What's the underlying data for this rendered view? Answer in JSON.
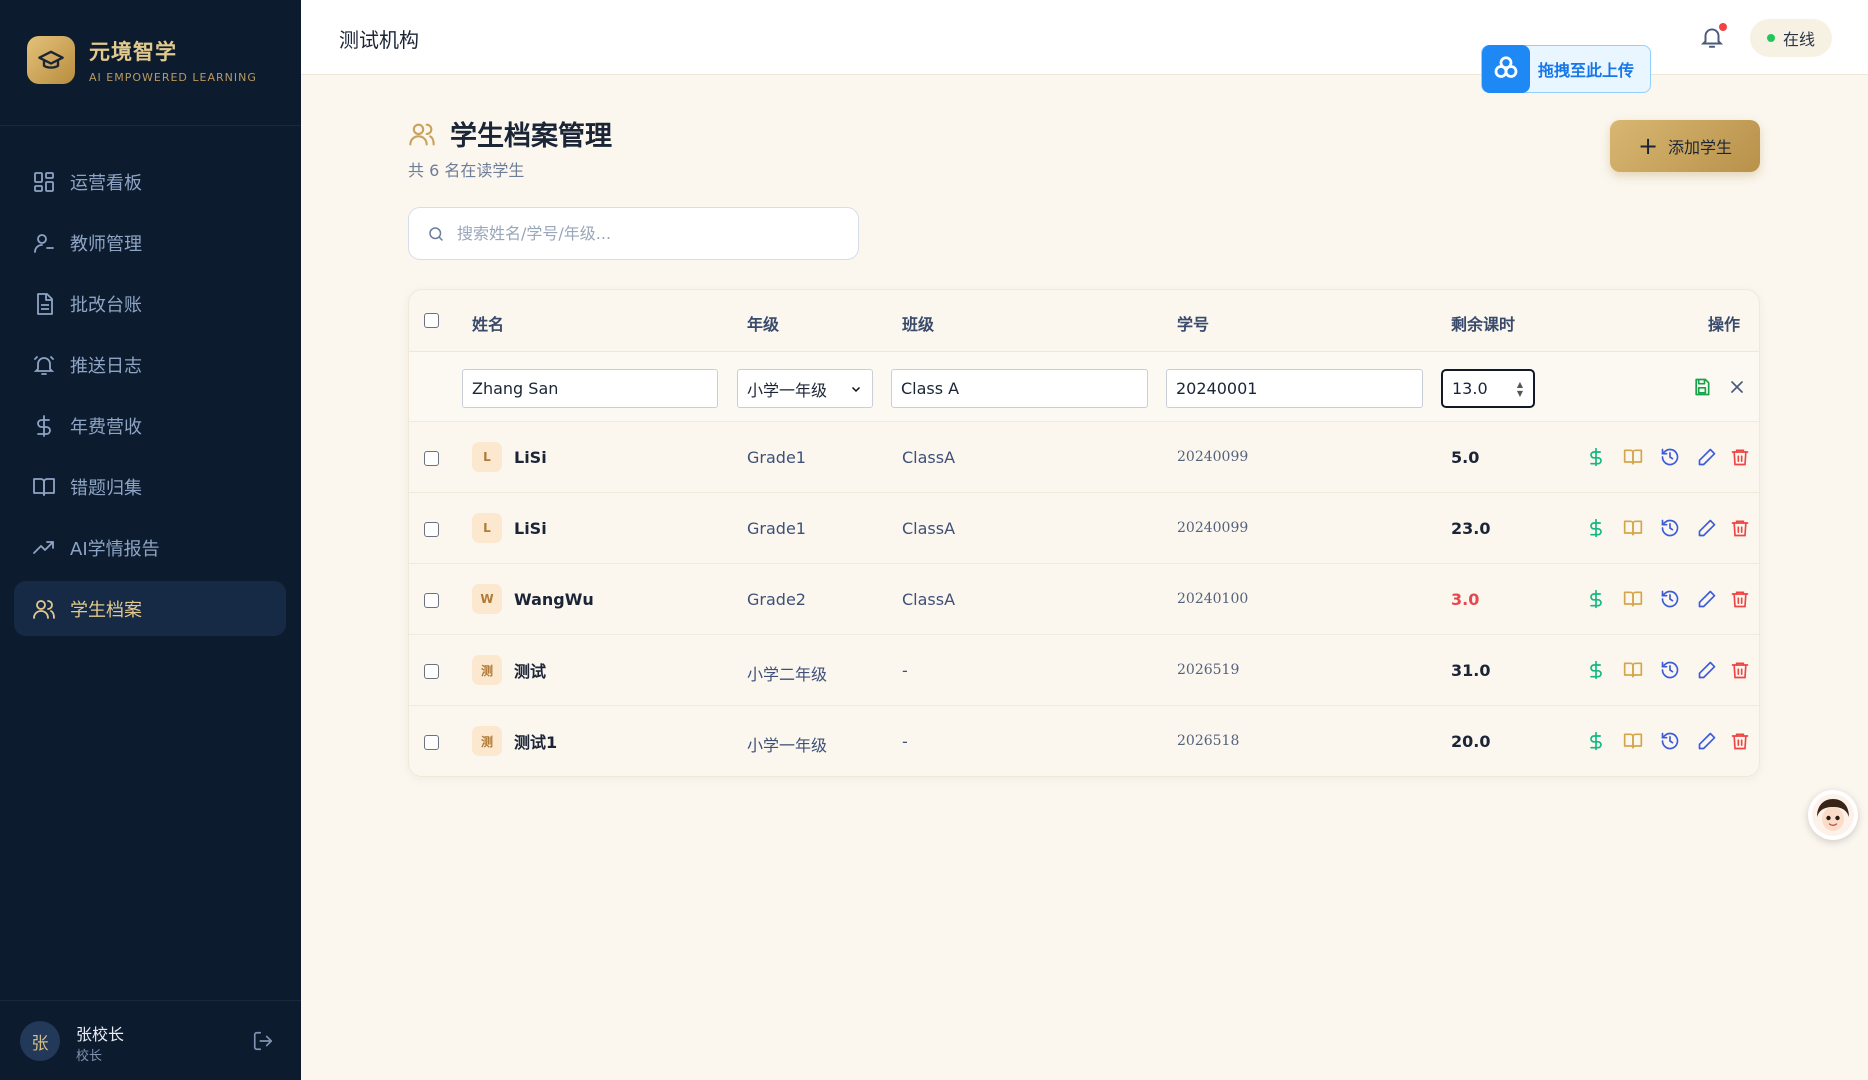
{
  "brand": {
    "name": "元境智学",
    "subtitle": "AI EMPOWERED LEARNING"
  },
  "sidebar": {
    "items": [
      {
        "label": "运营看板",
        "icon": "dashboard-icon"
      },
      {
        "label": "教师管理",
        "icon": "user-icon"
      },
      {
        "label": "批改台账",
        "icon": "document-icon"
      },
      {
        "label": "推送日志",
        "icon": "bell-icon"
      },
      {
        "label": "年费营收",
        "icon": "dollar-icon"
      },
      {
        "label": "错题归集",
        "icon": "book-icon"
      },
      {
        "label": "AI学情报告",
        "icon": "trending-up-icon"
      },
      {
        "label": "学生档案",
        "icon": "users-icon",
        "active": true
      }
    ],
    "user": {
      "avatar": "张",
      "name": "张校长",
      "role": "校长"
    }
  },
  "header": {
    "org": "测试机构",
    "status": "在线"
  },
  "upload": {
    "label": "拖拽至此上传"
  },
  "page": {
    "title": "学生档案管理",
    "count_text": "共 6 名在读学生",
    "add_label": "添加学生",
    "search_placeholder": "搜索姓名/学号/年级..."
  },
  "table": {
    "columns": {
      "name": "姓名",
      "grade": "年级",
      "class": "班级",
      "id": "学号",
      "hours": "剩余课时",
      "actions": "操作"
    },
    "edit_row": {
      "name": "Zhang San",
      "grade": "小学一年级",
      "class": "Class A",
      "id": "20240001",
      "hours": "13.0"
    },
    "rows": [
      {
        "initial": "L",
        "name": "LiSi",
        "grade": "Grade1",
        "class": "ClassA",
        "id": "20240099",
        "hours": "5.0",
        "low": false
      },
      {
        "initial": "L",
        "name": "LiSi",
        "grade": "Grade1",
        "class": "ClassA",
        "id": "20240099",
        "hours": "23.0",
        "low": false
      },
      {
        "initial": "W",
        "name": "WangWu",
        "grade": "Grade2",
        "class": "ClassA",
        "id": "20240100",
        "hours": "3.0",
        "low": true
      },
      {
        "initial": "测",
        "name": "测试",
        "grade": "小学二年级",
        "class": "-",
        "id": "2026519",
        "hours": "31.0",
        "low": false
      },
      {
        "initial": "测",
        "name": "测试1",
        "grade": "小学一年级",
        "class": "-",
        "id": "2026518",
        "hours": "20.0",
        "low": false
      }
    ]
  },
  "colors": {
    "sidebar_bg": "#0d1b2e",
    "accent_gold": "#d8b772",
    "low_hours": "#e5484d",
    "online": "#22c55e"
  }
}
